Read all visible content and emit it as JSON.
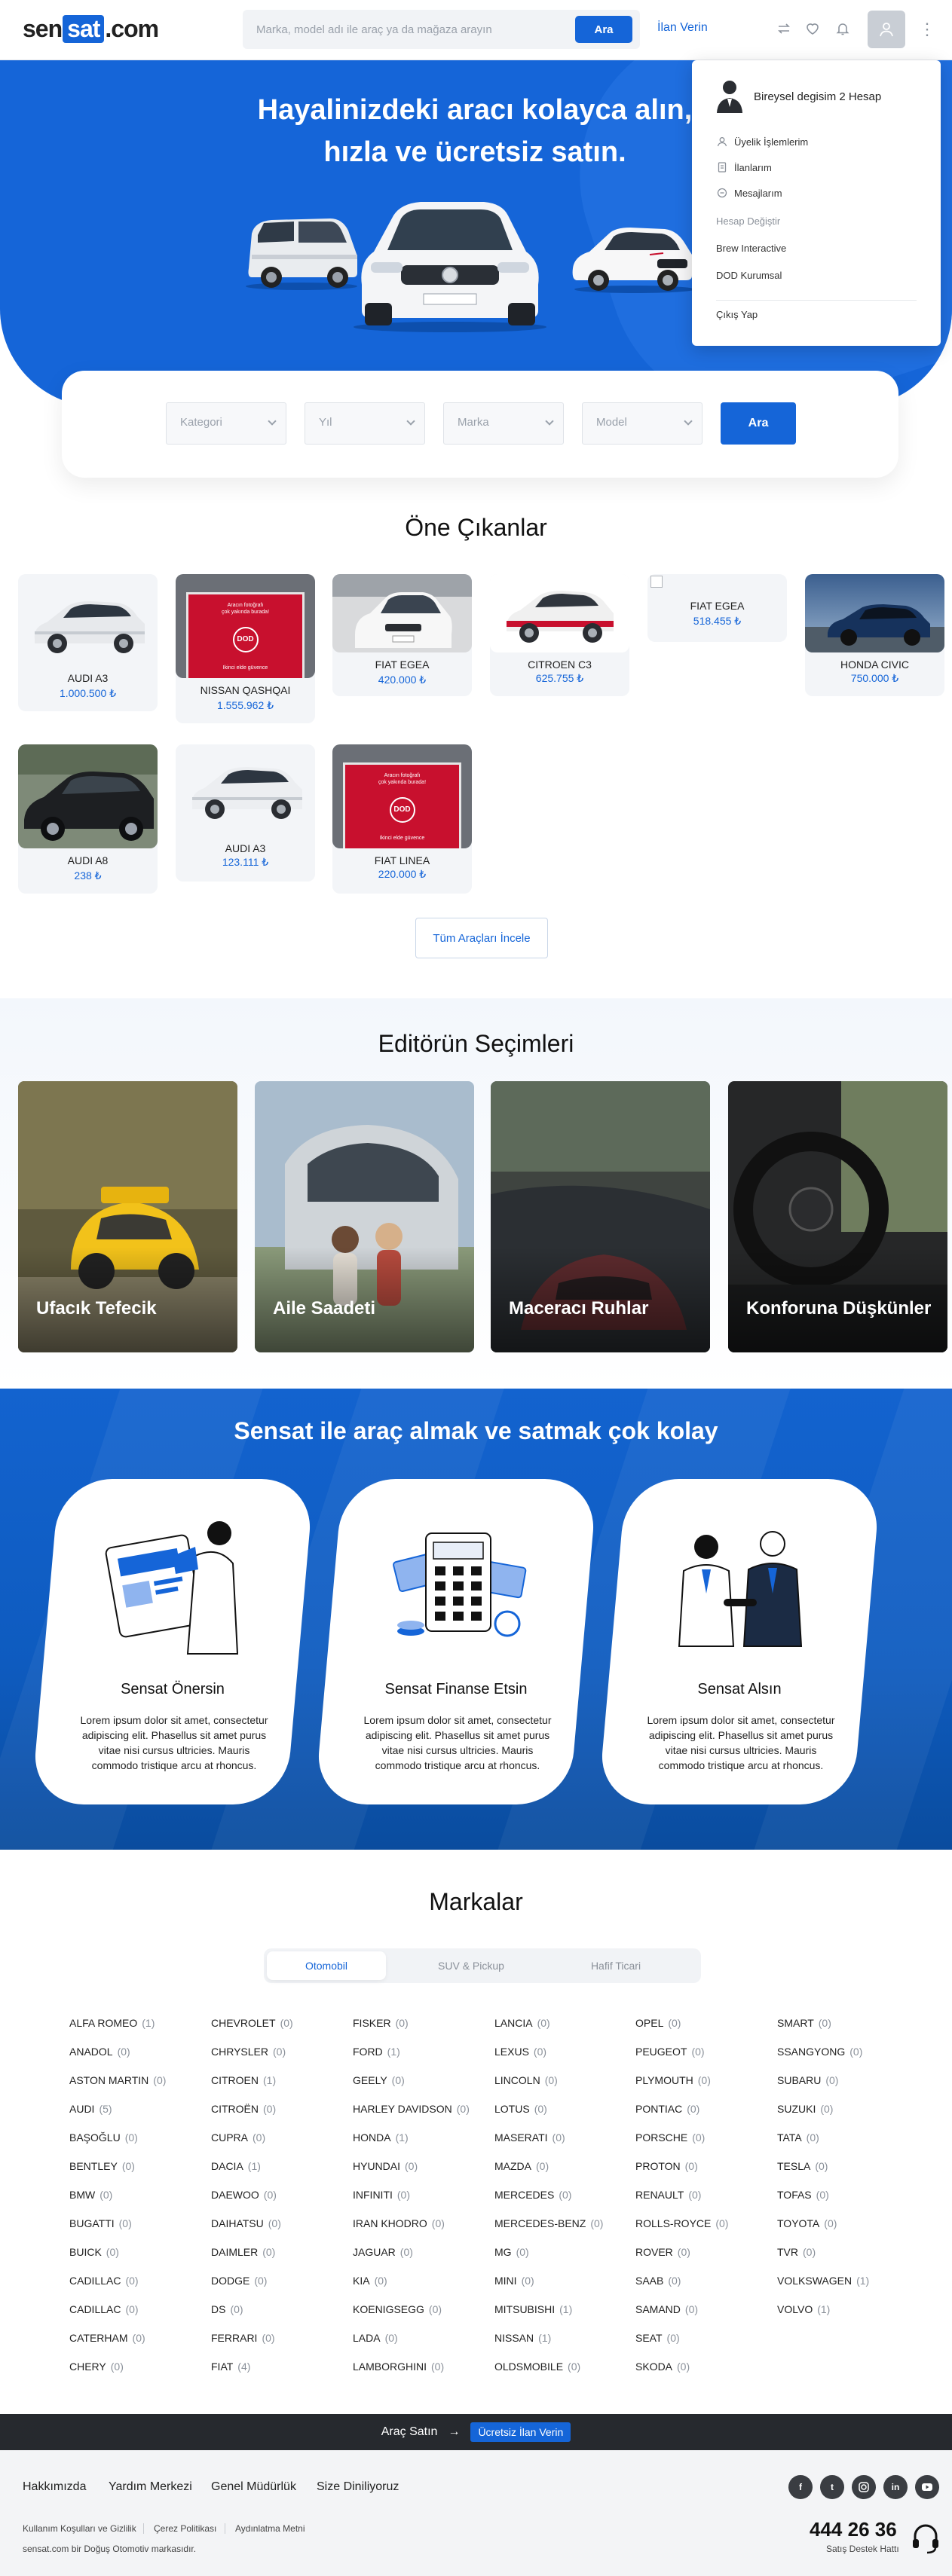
{
  "header": {
    "logo_left": "sen",
    "logo_mid": "sat",
    "logo_right": ".com",
    "search_placeholder": "Marka, model adı ile araç ya da mağaza arayın",
    "search_button": "Ara",
    "post_ad": "İlan Verin",
    "icons": [
      "swap-icon",
      "heart-icon",
      "bell-icon",
      "user-icon",
      "kebab-icon"
    ]
  },
  "account_menu": {
    "account_name": "Bireysel degisim 2 Hesap",
    "items": [
      {
        "label": "Üyelik İşlemlerim",
        "icon": "user-icon"
      },
      {
        "label": "İlanlarım",
        "icon": "document-icon"
      },
      {
        "label": "Mesajlarım",
        "icon": "message-icon"
      }
    ],
    "switch_account": "Hesap Değiştir",
    "accounts": [
      "Brew Interactive",
      "DOD Kurumsal"
    ],
    "logout": "Çıkış Yap"
  },
  "hero": {
    "title_line1": "Hayalinizdeki aracı kolayca alın,",
    "title_line2": "hızla ve ücretsiz satın."
  },
  "filter": {
    "kategori": "Kategori",
    "yil": "Yıl",
    "marka": "Marka",
    "model": "Model",
    "button": "Ara"
  },
  "featured": {
    "title": "Öne Çıkanlar",
    "cars": [
      {
        "name": "AUDI A3",
        "price": "1.000.500 ₺"
      },
      {
        "name": "NISSAN QASHQAI",
        "price": "1.555.962 ₺"
      },
      {
        "name": "FIAT EGEA",
        "price": "420.000 ₺"
      },
      {
        "name": "CITROEN C3",
        "price": "625.755 ₺"
      },
      {
        "name": "FIAT EGEA",
        "price": "518.455 ₺"
      },
      {
        "name": "HONDA CIVIC",
        "price": "750.000 ₺"
      },
      {
        "name": "AUDI A8",
        "price": "238 ₺"
      },
      {
        "name": "AUDI A3",
        "price": "123.111 ₺"
      },
      {
        "name": "FIAT LINEA",
        "price": "220.000 ₺"
      }
    ],
    "dod_caption": "Aracın fotoğrafı\nçok yakında burada!",
    "dod_sub": "Ikinci elde güvence",
    "dod_logo": "DOD",
    "all_button": "Tüm Araçları İncele"
  },
  "editors": {
    "title": "Editörün Seçimleri",
    "picks": [
      "Ufacık Tefecik",
      "Aile Saadeti",
      "Maceracı Ruhlar",
      "Konforuna Düşkünler"
    ]
  },
  "how": {
    "title": "Sensat ile araç almak ve satmak çok kolay",
    "steps": [
      {
        "title": "Sensat Önersin",
        "text": "Lorem ipsum dolor sit amet, consectetur adipiscing elit. Phasellus sit amet purus vitae nisi cursus ultricies. Mauris commodo tristique arcu at rhoncus."
      },
      {
        "title": "Sensat Finanse Etsin",
        "text": "Lorem ipsum dolor sit amet, consectetur adipiscing elit. Phasellus sit amet purus vitae nisi cursus ultricies. Mauris commodo tristique arcu at rhoncus."
      },
      {
        "title": "Sensat Alsın",
        "text": "Lorem ipsum dolor sit amet, consectetur adipiscing elit. Phasellus sit amet purus vitae nisi cursus ultricies. Mauris commodo tristique arcu at rhoncus."
      }
    ]
  },
  "brands": {
    "title": "Markalar",
    "tabs": [
      "Otomobil",
      "SUV & Pickup",
      "Hafif Ticari"
    ],
    "active_tab": "Otomobil",
    "columns": [
      [
        [
          "ALFA ROMEO",
          "(1)"
        ],
        [
          "ANADOL",
          "(0)"
        ],
        [
          "ASTON MARTIN",
          "(0)"
        ],
        [
          "AUDI",
          "(5)"
        ],
        [
          "BAŞOĞLU",
          "(0)"
        ],
        [
          "BENTLEY",
          "(0)"
        ],
        [
          "BMW",
          "(0)"
        ],
        [
          "BUGATTI",
          "(0)"
        ],
        [
          "BUICK",
          "(0)"
        ],
        [
          "CADILLAC",
          "(0)"
        ],
        [
          "CADILLAC",
          "(0)"
        ],
        [
          "CATERHAM",
          "(0)"
        ],
        [
          "CHERY",
          "(0)"
        ]
      ],
      [
        [
          "CHEVROLET",
          "(0)"
        ],
        [
          "CHRYSLER",
          "(0)"
        ],
        [
          "CITROEN",
          "(1)"
        ],
        [
          "CITROËN",
          "(0)"
        ],
        [
          "CUPRA",
          "(0)"
        ],
        [
          "DACIA",
          "(1)"
        ],
        [
          "DAEWOO",
          "(0)"
        ],
        [
          "DAIHATSU",
          "(0)"
        ],
        [
          "DAIMLER",
          "(0)"
        ],
        [
          "DODGE",
          "(0)"
        ],
        [
          "DS",
          "(0)"
        ],
        [
          "FERRARI",
          "(0)"
        ],
        [
          "FIAT",
          "(4)"
        ]
      ],
      [
        [
          "FISKER",
          "(0)"
        ],
        [
          "FORD",
          "(1)"
        ],
        [
          "GEELY",
          "(0)"
        ],
        [
          "HARLEY DAVIDSON",
          "(0)"
        ],
        [
          "HONDA",
          "(1)"
        ],
        [
          "HYUNDAI",
          "(0)"
        ],
        [
          "INFINITI",
          "(0)"
        ],
        [
          "IRAN KHODRO",
          "(0)"
        ],
        [
          "JAGUAR",
          "(0)"
        ],
        [
          "KIA",
          "(0)"
        ],
        [
          "KOENIGSEGG",
          "(0)"
        ],
        [
          "LADA",
          "(0)"
        ],
        [
          "LAMBORGHINI",
          "(0)"
        ]
      ],
      [
        [
          "LANCIA",
          "(0)"
        ],
        [
          "LEXUS",
          "(0)"
        ],
        [
          "LINCOLN",
          "(0)"
        ],
        [
          "LOTUS",
          "(0)"
        ],
        [
          "MASERATI",
          "(0)"
        ],
        [
          "MAZDA",
          "(0)"
        ],
        [
          "MERCEDES",
          "(0)"
        ],
        [
          "MERCEDES-BENZ",
          "(0)"
        ],
        [
          "MG",
          "(0)"
        ],
        [
          "MINI",
          "(0)"
        ],
        [
          "MITSUBISHI",
          "(1)"
        ],
        [
          "NISSAN",
          "(1)"
        ],
        [
          "OLDSMOBILE",
          "(0)"
        ]
      ],
      [
        [
          "OPEL",
          "(0)"
        ],
        [
          "PEUGEOT",
          "(0)"
        ],
        [
          "PLYMOUTH",
          "(0)"
        ],
        [
          "PONTIAC",
          "(0)"
        ],
        [
          "PORSCHE",
          "(0)"
        ],
        [
          "PROTON",
          "(0)"
        ],
        [
          "RENAULT",
          "(0)"
        ],
        [
          "ROLLS-ROYCE",
          "(0)"
        ],
        [
          "ROVER",
          "(0)"
        ],
        [
          "SAAB",
          "(0)"
        ],
        [
          "SAMAND",
          "(0)"
        ],
        [
          "SEAT",
          "(0)"
        ],
        [
          "SKODA",
          "(0)"
        ]
      ],
      [
        [
          "SMART",
          "(0)"
        ],
        [
          "SSANGYONG",
          "(0)"
        ],
        [
          "SUBARU",
          "(0)"
        ],
        [
          "SUZUKI",
          "(0)"
        ],
        [
          "TATA",
          "(0)"
        ],
        [
          "TESLA",
          "(0)"
        ],
        [
          "TOFAS",
          "(0)"
        ],
        [
          "TOYOTA",
          "(0)"
        ],
        [
          "TVR",
          "(0)"
        ],
        [
          "VOLKSWAGEN",
          "(1)"
        ],
        [
          "VOLVO",
          "(1)"
        ]
      ]
    ]
  },
  "sell_strip": {
    "label": "Araç Satın",
    "arrow": "→",
    "pill": "Ücretsiz İlan Verin"
  },
  "footer": {
    "links": [
      "Hakkımızda",
      "Yardım Merkezi",
      "Genel Müdürlük",
      "Size Diniliyoruz"
    ],
    "social": [
      "facebook-icon",
      "twitter-icon",
      "instagram-icon",
      "linkedin-icon",
      "youtube-icon"
    ],
    "legal": [
      "Kullanım Koşulları ve Gizlilik",
      "Çerez Politikası",
      "Aydınlatma Metni"
    ],
    "copyright": "sensat.com bir Doğuş Otomotiv markasıdır.",
    "phone": "444 26 36",
    "phone_label": "Satış Destek Hattı"
  },
  "colors": {
    "brand": "#1565d8",
    "dark": "#26292e",
    "card_bg": "#f3f5f8",
    "dod_red": "#c8102e"
  }
}
